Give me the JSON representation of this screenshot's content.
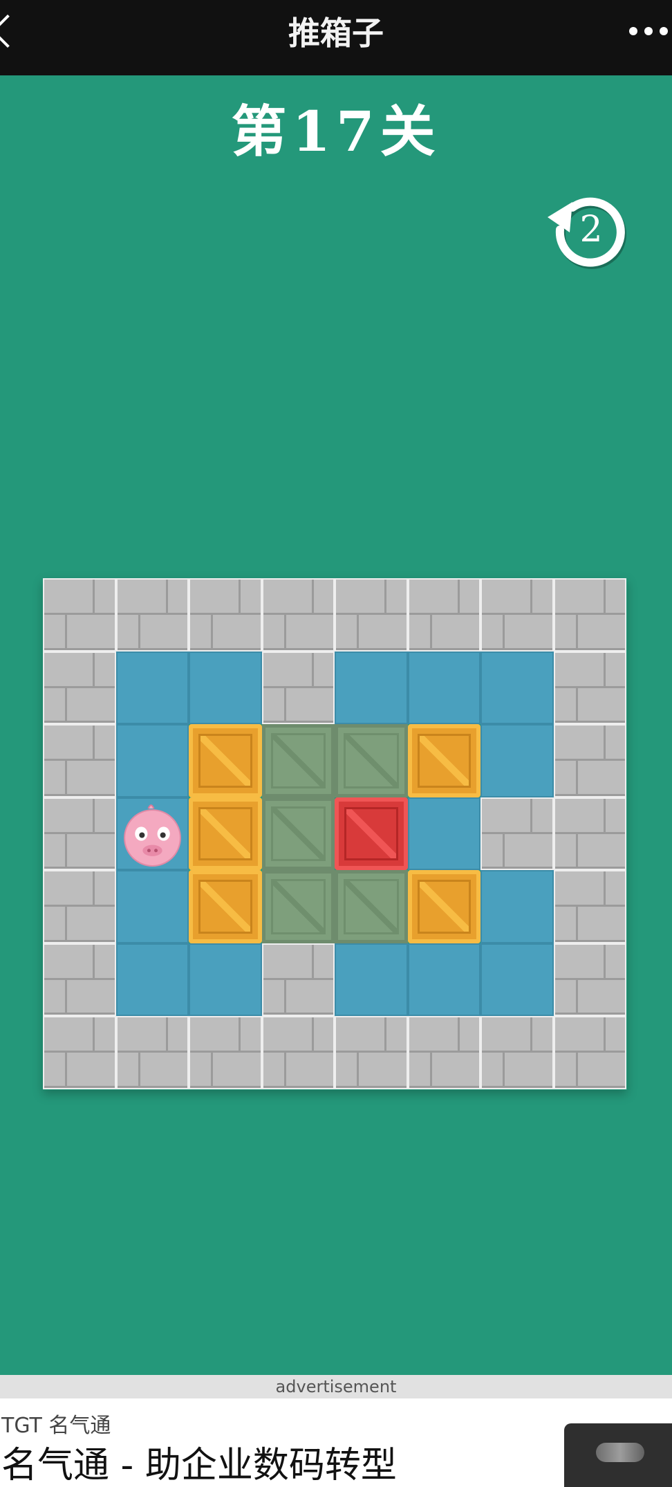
{
  "topbar": {
    "title": "推箱子",
    "back_icon": "chevron-left-icon",
    "more_icon": "more-dots-icon"
  },
  "level": {
    "title": "第17关"
  },
  "undo": {
    "icon": "undo-arrow-icon",
    "count": "2"
  },
  "board": {
    "rows": 7,
    "cols": 8,
    "legend": {
      "W": "wall",
      "F": "floor",
      "G": "goal",
      "B": "box",
      "R": "box-on-goal",
      "P": "player"
    },
    "grid": [
      "WWWWWWWW",
      "WFFWFFFW",
      "WFBGGBFW",
      "WPBGRFWW",
      "WFBGGBFW",
      "WFFWFFFW",
      "WWWWWWWW"
    ]
  },
  "ad": {
    "label": "advertisement",
    "advertiser": "TGT 名气通",
    "headline": "名气通 - 助企业数码转型"
  },
  "colors": {
    "background": "#24987a",
    "topbar": "#111111",
    "floor": "#4aa0be",
    "wall": "#bdbdbd",
    "box": "#e8a02d",
    "box_on_goal": "#d83a3a",
    "goal": "#7e9f7c",
    "player": "#f4a9c0"
  }
}
